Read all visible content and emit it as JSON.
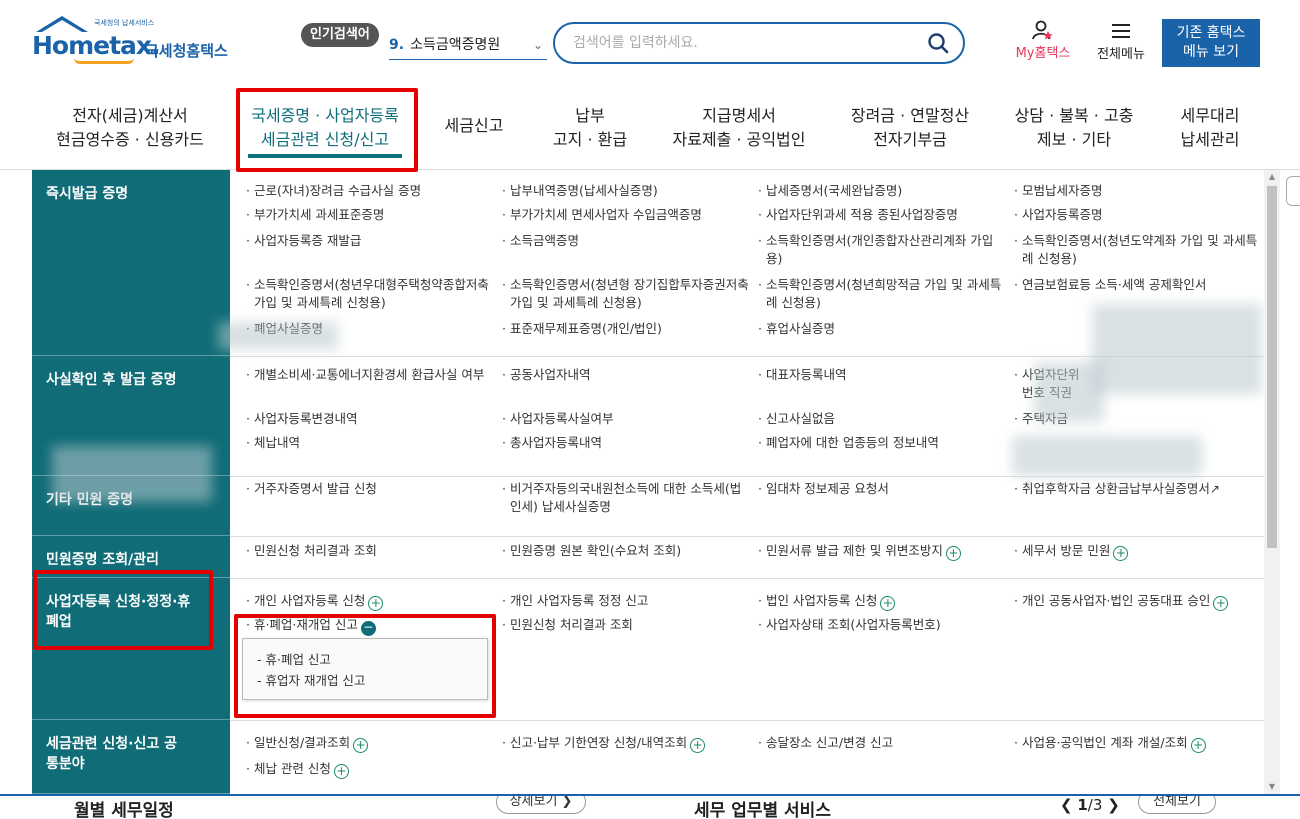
{
  "header": {
    "logo_tagline": "국세청의 납세서비스",
    "logo_brand": "Hometax.",
    "logo_kr": "국세청홈택스",
    "popular_badge": "인기검색어",
    "popular_rank": "9.",
    "popular_term": "소득금액증명원",
    "search_placeholder": "검색어를 입력하세요.",
    "my_hometax": "My홈택스",
    "all_menu": "전체메뉴",
    "old_home_line1": "기존 홈택스",
    "old_home_line2": "메뉴 보기"
  },
  "gnb": [
    {
      "line1": "전자(세금)계산서",
      "line2": "현금영수증 · 신용카드"
    },
    {
      "line1": "국세증명 · 사업자등록",
      "line2": "세금관련 신청/신고"
    },
    {
      "line1": "세금신고",
      "line2": ""
    },
    {
      "line1": "납부",
      "line2": "고지 · 환급"
    },
    {
      "line1": "지급명세서",
      "line2": "자료제출 · 공익법인"
    },
    {
      "line1": "장려금 · 연말정산",
      "line2": "전자기부금"
    },
    {
      "line1": "상담 · 불복 · 고충",
      "line2": "제보 · 기타"
    },
    {
      "line1": "세무대리",
      "line2": "납세관리"
    }
  ],
  "categories": {
    "c1": "즉시발급 증명",
    "c2": "사실확인 후 발급 증명",
    "c3": "기타 민원 증명",
    "c4": "민원증명 조회/관리",
    "c5": "사업자등록 신청·정정·휴폐업",
    "c6": "세금관련 신청·신고 공통분야"
  },
  "items": {
    "r1a": "· 근로(자녀)장려금 수급사실 증명",
    "r1b": "· 납부내역증명(납세사실증명)",
    "r1c": "· 납세증명서(국세완납증명)",
    "r1d": "· 모범납세자증명",
    "r1e": "· 부가가치세 과세표준증명",
    "r1f": "· 부가가치세 면세사업자 수입금액증명",
    "r1g": "· 사업자단위과세 적용 종된사업장증명",
    "r1h": "· 사업자등록증명",
    "r1i": "· 사업자등록증 재발급",
    "r1j": "· 소득금액증명",
    "r1k": "· 소득확인증명서(개인종합자산관리계좌 가입용)",
    "r1l": "· 소득확인증명서(청년도약계좌 가입 및 과세특례 신청용)",
    "r1m": "· 소득확인증명서(청년우대형주택청약종합저축 가입 및 과세특례 신청용)",
    "r1n": "· 소득확인증명서(청년형 장기집합투자증권저축 가입 및 과세특례 신청용)",
    "r1o": "· 소득확인증명서(청년희망적금 가입 및 과세특례 신청용)",
    "r1p": "· 연금보험료등 소득·세액 공제확인서",
    "r1q": "· 폐업사실증명",
    "r1r": "· 표준재무제표증명(개인/법인)",
    "r1s": "· 휴업사실증명",
    "r2a": "· 개별소비세·교통에너지환경세 환급사실 여부",
    "r2b": "· 공동사업자내역",
    "r2c": "· 대표자등록내역",
    "r2d": "· 사업자단위",
    "r2d2": "번호 직권",
    "r2e": "· 사업자등록변경내역",
    "r2f": "· 사업자등록사실여부",
    "r2g": "· 신고사실없음",
    "r2h": "· 주택자금",
    "r2i": "· 체납내역",
    "r2j": "· 총사업자등록내역",
    "r2k": "· 폐업자에 대한 업종등의 정보내역",
    "r3a": "· 거주자증명서 발급 신청",
    "r3b": "· 비거주자등의국내원천소득에 대한 소득세(법인세) 납세사실증명",
    "r3c": "· 임대차 정보제공 요청서",
    "r3d": "· 취업후학자금 상환금납부사실증명서",
    "r4a": "· 민원신청 처리결과 조회",
    "r4b": "· 민원증명 원본 확인(수요처 조회)",
    "r4c": "· 민원서류 발급 제한 및 위변조방지",
    "r4d": "· 세무서 방문 민원",
    "r5a": "· 개인 사업자등록 신청",
    "r5b": "· 개인 사업자등록 정정 신고",
    "r5c": "· 법인 사업자등록 신청",
    "r5d": "· 개인 공동사업자·법인 공동대표 승인",
    "r5e": "· 휴·폐업·재개업 신고",
    "r5f": "· 민원신청 처리결과 조회",
    "r5g": "· 사업자상태 조회(사업자등록번호)",
    "sub1": "- 휴·폐업 신고",
    "sub2": "- 휴업자 재개업 신고",
    "r6a": "· 일반신청/결과조회",
    "r6b": "· 신고·납부 기한연장 신청/내역조회",
    "r6c": "· 송달장소 신고/변경 신고",
    "r6d": "· 사업용·공익법인 계좌 개설/조회",
    "r6e": "· 체납 관련 신청"
  },
  "bottom": {
    "title1": "월별 세무일정",
    "more1": "상세보기 ❯",
    "title2": "세무 업무별 서비스",
    "pager_prev": "❮",
    "pager_cur": "1",
    "pager_sep": "/3",
    "pager_next": "❯",
    "more2": "전체보기"
  },
  "colors": {
    "brand_blue": "#1a63a8",
    "teal": "#106c77",
    "highlight_red": "#e50000",
    "my_pink": "#e8365b"
  }
}
